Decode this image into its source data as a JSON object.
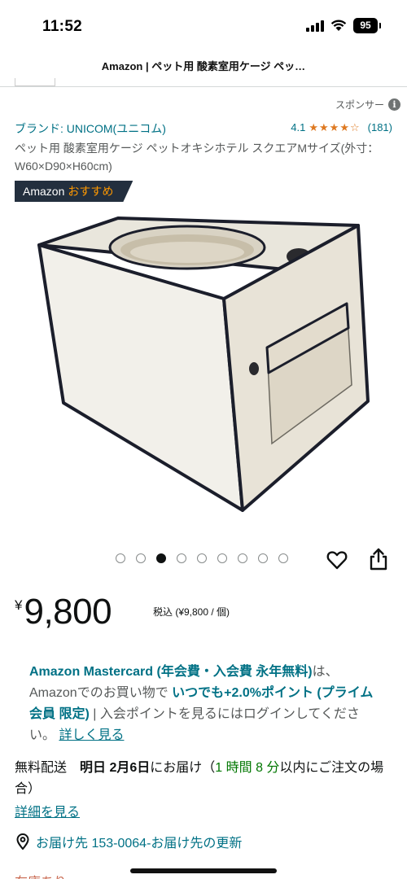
{
  "status_bar": {
    "time": "11:52",
    "battery": "95",
    "icons": [
      "signal-icon",
      "wifi-icon",
      "battery-icon"
    ]
  },
  "page_title": "Amazon | ペット用 酸素室用ケージ ペッ…",
  "sponsor": {
    "label": "スポンサー",
    "icon": "info-icon"
  },
  "brand": {
    "link": "ブランド: UNICOM(ユニコム)"
  },
  "rating": {
    "value": "4.1",
    "stars": 4.1,
    "count": "(181)"
  },
  "product": {
    "title": "ペット用 酸素室用ケージ ペットオキシホテル スクエアMサイズ(外寸：W60×D90×H60cm)"
  },
  "badge": {
    "prefix": "Amazon",
    "accent": "おすすめ"
  },
  "carousel": {
    "total": 9,
    "active_index": 2
  },
  "actions": {
    "wishlist_icon": "heart-icon",
    "share_icon": "share-icon"
  },
  "price": {
    "currency": "¥",
    "value": "9,800",
    "note": "税込 (¥9,800 / 個)"
  },
  "promo": {
    "part1": "Amazon Mastercard (年会費・入会費 永年無料)",
    "part2": "は、Amazonでのお買い物で ",
    "part3": "いつでも+2.0%ポイント (プライム会員 限定)",
    "part4": " | 入会ポイントを見るにはログインしてください。 ",
    "link": "詳しく見る"
  },
  "delivery": {
    "prefix": "無料配送",
    "date": "明日 2月6日",
    "middle": "にお届け（",
    "countdown": "1 時間 8 分",
    "suffix": "以内にご注文の場合）",
    "details_link": "詳細を見る"
  },
  "address": {
    "text": "お届け先 153-0064-お届け先の更新",
    "icon": "location-pin-icon"
  },
  "bottom_partial": "在庫あり",
  "colors": {
    "link": "#007185",
    "star": "#de7921",
    "badge_bg": "#232f3e",
    "badge_accent": "#ff9900",
    "green": "#007600"
  }
}
